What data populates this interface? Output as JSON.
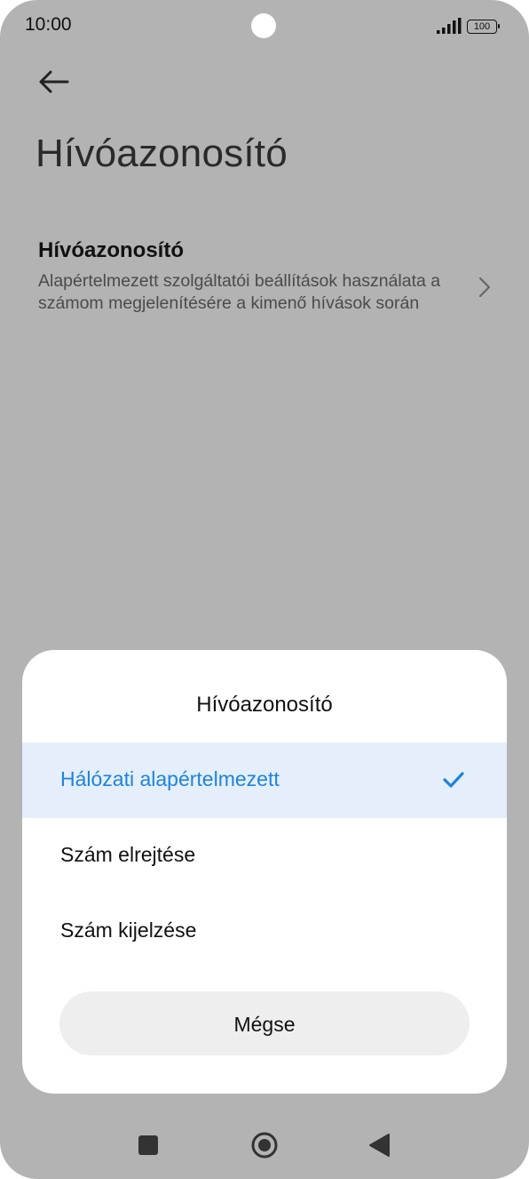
{
  "status_bar": {
    "time": "10:00",
    "battery": "100",
    "icons": [
      "signal-icon",
      "battery-icon"
    ]
  },
  "header": {
    "back_icon": "back-arrow-icon",
    "title": "Hívóazonosító"
  },
  "setting": {
    "title": "Hívóazonosító",
    "description": "Alapértelmezett szolgáltatói beállítások használata a számom megjelenítésére a kimenő hívások során",
    "chevron_icon": "chevron-right-icon"
  },
  "dialog": {
    "title": "Hívóazonosító",
    "options": [
      {
        "label": "Hálózati alapértelmezett",
        "selected": true
      },
      {
        "label": "Szám elrejtése",
        "selected": false
      },
      {
        "label": "Szám kijelzése",
        "selected": false
      }
    ],
    "cancel_label": "Mégse"
  },
  "nav_bar": {
    "icons": [
      "recents-icon",
      "home-icon",
      "back-icon"
    ]
  },
  "colors": {
    "accent": "#1f83de",
    "selected_background": "#e4effb",
    "scrim": "#b3b3b3"
  }
}
